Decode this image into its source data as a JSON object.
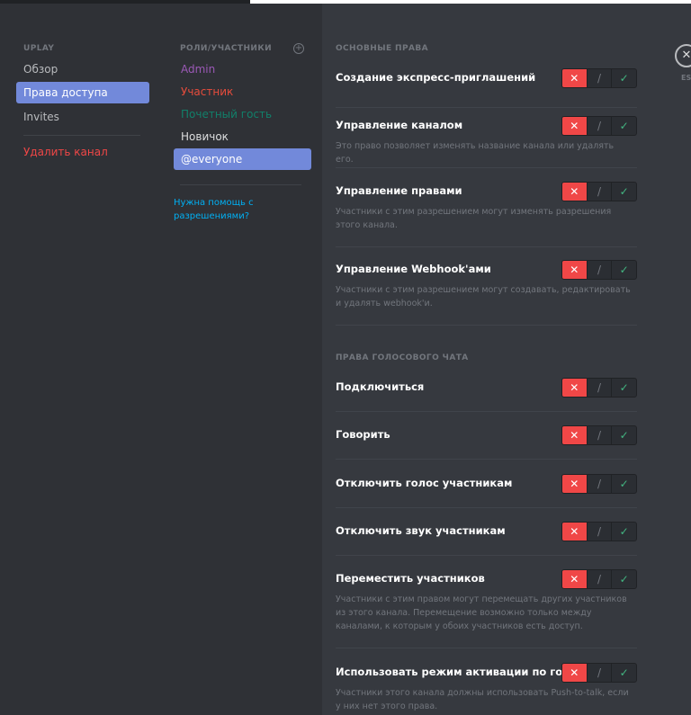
{
  "colors": {
    "accent": "#7289da",
    "danger": "#f04747",
    "success": "#43b581",
    "link": "#00b0f4"
  },
  "sidebar": {
    "header": "UPLAY",
    "items": [
      {
        "label": "Обзор"
      },
      {
        "label": "Права доступа"
      },
      {
        "label": "Invites"
      }
    ],
    "delete_label": "Удалить канал"
  },
  "roles": {
    "header": "РОЛИ/УЧАСТНИКИ",
    "add_icon": "plus-circle-icon",
    "items": [
      {
        "label": "Admin",
        "color": "#9b59b6"
      },
      {
        "label": "Участник",
        "color": "#e74c3c"
      },
      {
        "label": "Почетный гость",
        "color": "#11806a"
      },
      {
        "label": "Новичок",
        "color": "#dcddde"
      },
      {
        "label": "@everyone",
        "color": "#ffffff"
      }
    ],
    "help": "Нужна помощь с разрешениями?"
  },
  "general": {
    "header": "ОСНОВНЫЕ ПРАВА",
    "perms": [
      {
        "title": "Создание экспресс-приглашений",
        "desc": ""
      },
      {
        "title": "Управление каналом",
        "desc": "Это право позволяет изменять название канала или удалять его."
      },
      {
        "title": "Управление правами",
        "desc": "Участники с этим разрешением могут изменять разрешения этого канала."
      },
      {
        "title": "Управление Webhook'ами",
        "desc": "Участники с этим разрешением могут создавать, редактировать и удалять webhook'и."
      }
    ]
  },
  "voice": {
    "header": "ПРАВА ГОЛОСОВОГО ЧАТА",
    "perms": [
      {
        "title": "Подключиться",
        "desc": ""
      },
      {
        "title": "Говорить",
        "desc": ""
      },
      {
        "title": "Отключить голос участникам",
        "desc": ""
      },
      {
        "title": "Отключить звук участникам",
        "desc": ""
      },
      {
        "title": "Переместить участников",
        "desc": "Участники с этим правом могут перемещать других участников из этого канала. Перемещение возможно только между каналами, к которым у обоих участников есть доступ."
      },
      {
        "title": "Использовать режим активации по голосу",
        "desc": "Участники этого канала должны использовать Push-to-talk, если у них нет этого права."
      }
    ]
  },
  "toggle": {
    "deny": "✕",
    "neutral": "/",
    "allow": "✓",
    "state": "deny"
  },
  "close": {
    "icon": "✕",
    "label": "ESC"
  }
}
